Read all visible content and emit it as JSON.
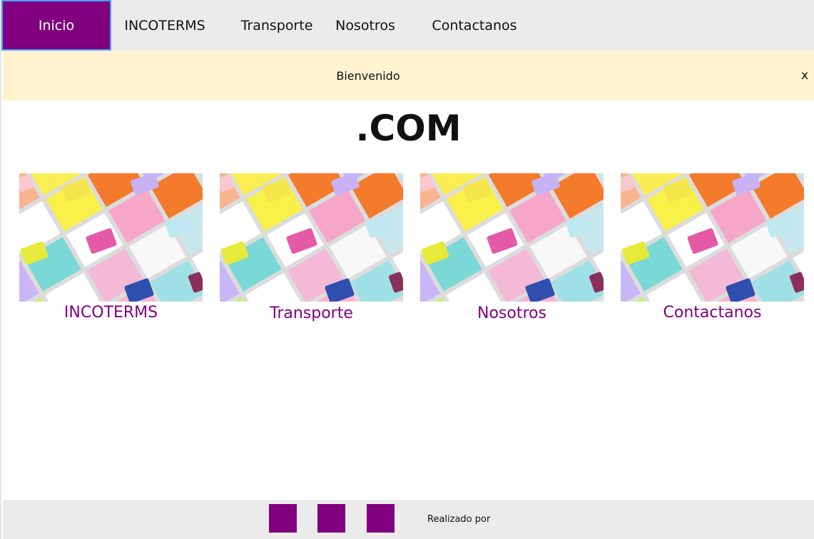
{
  "nav": {
    "items": [
      {
        "label": "Inicio",
        "active": true
      },
      {
        "label": "INCOTERMS",
        "active": false
      },
      {
        "label": "Transporte",
        "active": false
      },
      {
        "label": "Nosotros",
        "active": false
      },
      {
        "label": "Contactanos",
        "active": false
      }
    ]
  },
  "banner": {
    "text": "Bienvenido",
    "close_label": "x"
  },
  "heading": ".COM",
  "cards": [
    {
      "label": "INCOTERMS",
      "image": "colorful-speech-bubbles-image"
    },
    {
      "label": "Transporte",
      "image": "colorful-speech-bubbles-image"
    },
    {
      "label": "Nosotros",
      "image": "colorful-speech-bubbles-image"
    },
    {
      "label": "Contactanos",
      "image": "colorful-speech-bubbles-image"
    }
  ],
  "footer": {
    "social_icons": [
      "social-icon",
      "social-icon",
      "social-icon"
    ],
    "credits": "Realizado por"
  },
  "colors": {
    "accent": "#800080",
    "nav_background": "#ebebeb",
    "banner_background": "#fff3d0",
    "active_border": "#4aa3ff"
  }
}
